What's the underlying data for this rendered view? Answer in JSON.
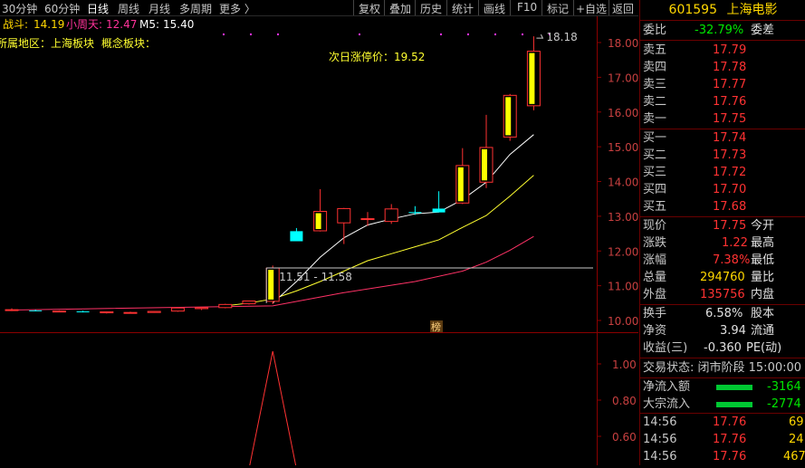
{
  "toolbar": {
    "tabs": [
      "30分钟",
      "60分钟",
      "日线",
      "周线",
      "月线",
      "多周期",
      "更多 〉"
    ],
    "active_tab": 2,
    "actions": [
      "复权",
      "叠加",
      "历史",
      "统计",
      "画线",
      "F10",
      "标记",
      "+自选",
      "返回"
    ]
  },
  "indicators": {
    "zhandou_label": "战斗:",
    "zhandou_value": "14.19",
    "xiaozhoutian_label": "小周天:",
    "xiaozhoutian_value": "12.47",
    "m5_label": "M5:",
    "m5_value": "15.40",
    "region_text": "所属地区：上海板块",
    "concept_text": "概念板块：",
    "limit_up_text": "次日涨停价：19.52",
    "range_label": "11.51 - 11.58",
    "high_label": "18.18",
    "badge_text": "榜"
  },
  "colors": {
    "up": "#ff3232",
    "down": "#00e600",
    "price": "#ffd700",
    "ma_white": "#ffffff",
    "ma_yellow": "#ffff30",
    "ma_pink": "#ff3266"
  },
  "chart_data": {
    "type": "candlestick",
    "y_ticks": [
      "18.00",
      "17.00",
      "16.00",
      "15.00",
      "14.00",
      "13.00",
      "12.00",
      "11.00",
      "10.00"
    ],
    "ylim": [
      9.75,
      18.25
    ],
    "sub_y_ticks": [
      "1.00",
      "0.80",
      "0.60",
      "0.40"
    ],
    "sub_ylim": [
      0.25,
      1.05
    ],
    "candles": [
      {
        "o": 10.3,
        "h": 10.35,
        "l": 10.27,
        "c": 10.31
      },
      {
        "o": 10.29,
        "h": 10.31,
        "l": 10.26,
        "c": 10.28
      },
      {
        "o": 10.26,
        "h": 10.29,
        "l": 10.25,
        "c": 10.27
      },
      {
        "o": 10.26,
        "h": 10.28,
        "l": 10.23,
        "c": 10.24
      },
      {
        "o": 10.22,
        "h": 10.26,
        "l": 10.2,
        "c": 10.25
      },
      {
        "o": 10.22,
        "h": 10.25,
        "l": 10.2,
        "c": 10.23
      },
      {
        "o": 10.23,
        "h": 10.27,
        "l": 10.22,
        "c": 10.26
      },
      {
        "o": 10.27,
        "h": 10.37,
        "l": 10.25,
        "c": 10.36
      },
      {
        "o": 10.34,
        "h": 10.38,
        "l": 10.3,
        "c": 10.37
      },
      {
        "o": 10.37,
        "h": 10.48,
        "l": 10.35,
        "c": 10.46
      },
      {
        "o": 10.48,
        "h": 10.57,
        "l": 10.46,
        "c": 10.56
      },
      {
        "o": 10.55,
        "h": 11.58,
        "l": 10.47,
        "c": 11.51
      },
      {
        "o": 12.57,
        "h": 12.66,
        "l": 12.28,
        "c": 12.28
      },
      {
        "o": 12.58,
        "h": 13.78,
        "l": 12.56,
        "c": 13.14
      },
      {
        "o": 12.81,
        "h": 13.24,
        "l": 12.2,
        "c": 13.22
      },
      {
        "o": 12.92,
        "h": 13.12,
        "l": 12.72,
        "c": 12.93
      },
      {
        "o": 12.85,
        "h": 13.35,
        "l": 12.78,
        "c": 13.21
      },
      {
        "o": 13.12,
        "h": 13.29,
        "l": 13.04,
        "c": 13.09
      },
      {
        "o": 13.22,
        "h": 13.72,
        "l": 13.15,
        "c": 13.11
      },
      {
        "o": 13.38,
        "h": 14.96,
        "l": 13.35,
        "c": 14.46
      },
      {
        "o": 13.98,
        "h": 15.92,
        "l": 13.81,
        "c": 14.98
      },
      {
        "o": 15.28,
        "h": 16.52,
        "l": 15.17,
        "c": 16.48
      },
      {
        "o": 16.18,
        "h": 18.18,
        "l": 16.05,
        "c": 17.75
      }
    ],
    "ma_white": [
      [
        11,
        10.5
      ],
      [
        12,
        11.12
      ],
      [
        13,
        11.82
      ],
      [
        14,
        12.38
      ],
      [
        15,
        12.75
      ],
      [
        16,
        12.92
      ],
      [
        17,
        13.07
      ],
      [
        18,
        13.12
      ],
      [
        19,
        13.48
      ],
      [
        20,
        13.98
      ],
      [
        21,
        14.78
      ],
      [
        22,
        15.35
      ]
    ],
    "ma_yellow": [
      [
        9,
        10.42
      ],
      [
        10,
        10.5
      ],
      [
        11,
        10.62
      ],
      [
        12,
        10.85
      ],
      [
        13,
        11.12
      ],
      [
        14,
        11.42
      ],
      [
        15,
        11.72
      ],
      [
        16,
        11.92
      ],
      [
        17,
        12.12
      ],
      [
        18,
        12.32
      ],
      [
        19,
        12.68
      ],
      [
        20,
        13.02
      ],
      [
        21,
        13.58
      ],
      [
        22,
        14.18
      ]
    ],
    "ma_pink": [
      [
        0,
        10.3
      ],
      [
        11,
        10.42
      ],
      [
        14,
        10.8
      ],
      [
        17,
        11.12
      ],
      [
        19,
        11.42
      ],
      [
        20,
        11.68
      ],
      [
        21,
        12.02
      ],
      [
        22,
        12.42
      ]
    ],
    "sub_series": [
      [
        10,
        0.0
      ],
      [
        11,
        1.0
      ],
      [
        12,
        0.0
      ]
    ]
  },
  "quote": {
    "code": "601595",
    "name": "上海电影",
    "weibi_label": "委比",
    "weibi_value": "-32.79%",
    "weicha_label": "委差",
    "asks": [
      {
        "label": "卖五",
        "price": "17.79"
      },
      {
        "label": "卖四",
        "price": "17.78"
      },
      {
        "label": "卖三",
        "price": "17.77"
      },
      {
        "label": "卖二",
        "price": "17.76"
      },
      {
        "label": "卖一",
        "price": "17.75"
      }
    ],
    "bids": [
      {
        "label": "买一",
        "price": "17.74"
      },
      {
        "label": "买二",
        "price": "17.73"
      },
      {
        "label": "买三",
        "price": "17.72"
      },
      {
        "label": "买四",
        "price": "17.70"
      },
      {
        "label": "买五",
        "price": "17.68"
      }
    ],
    "stats": [
      {
        "l1": "现价",
        "v1": "17.75",
        "l2": "今开",
        "c": "red"
      },
      {
        "l1": "涨跌",
        "v1": "1.22",
        "l2": "最高",
        "c": "red"
      },
      {
        "l1": "涨幅",
        "v1": "7.38%",
        "l2": "最低",
        "c": "red"
      },
      {
        "l1": "总量",
        "v1": "294760",
        "l2": "量比",
        "c": "yellow"
      },
      {
        "l1": "外盘",
        "v1": "135756",
        "l2": "内盘",
        "c": "red"
      }
    ],
    "stats2": [
      {
        "l1": "换手",
        "v1": "6.58%",
        "l2": "股本"
      },
      {
        "l1": "净资",
        "v1": "3.94",
        "l2": "流通"
      },
      {
        "l1": "收益(三)",
        "v1": "-0.360",
        "l2": "PE(动)"
      }
    ],
    "trade_status": "交易状态: 闭市阶段 15:00:00",
    "flows": [
      {
        "label": "净流入额",
        "value": "-3164"
      },
      {
        "label": "大宗流入",
        "value": "-2774"
      }
    ],
    "ticks": [
      {
        "time": "14:56",
        "price": "17.76",
        "vol": "69"
      },
      {
        "time": "14:56",
        "price": "17.76",
        "vol": "24"
      },
      {
        "time": "14:56",
        "price": "17.76",
        "vol": "467"
      }
    ]
  }
}
